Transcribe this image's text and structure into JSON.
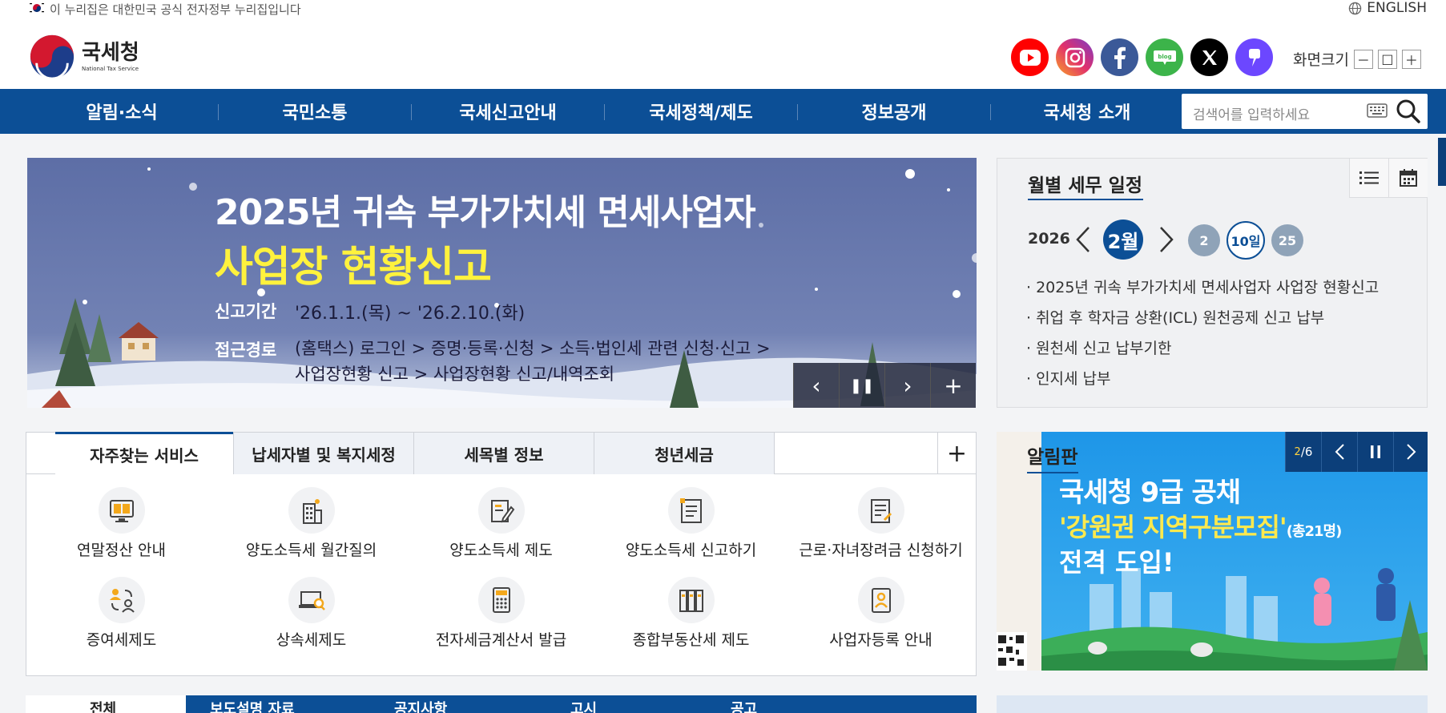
{
  "gov": {
    "text": "이 누리집은 대한민국 공식 전자정부 누리집입니다",
    "lang": "ENGLISH"
  },
  "logo": {
    "name": "국세청",
    "sub": "National Tax Service"
  },
  "sns": [
    {
      "name": "youtube",
      "color": "#ff0000"
    },
    {
      "name": "instagram",
      "color": "#d6249f"
    },
    {
      "name": "facebook",
      "color": "#3b5998"
    },
    {
      "name": "blog",
      "color": "#3cb44a"
    },
    {
      "name": "x",
      "color": "#000000"
    },
    {
      "name": "kakao",
      "color": "#6c47ff"
    }
  ],
  "zoom": {
    "label": "화면크기",
    "minus": "－",
    "reset": "□",
    "plus": "＋"
  },
  "nav": [
    "알림·소식",
    "국민소통",
    "국세신고안내",
    "국세정책/제도",
    "정보공개",
    "국세청 소개"
  ],
  "search": {
    "placeholder": "검색어를 입력하세요"
  },
  "banner": {
    "title1": "2025년 귀속 부가가치세 면세사업자",
    "title2": "사업장 현황신고",
    "row1_label": "신고기간",
    "row1_value": "'26.1.1.(목) ~ '26.2.10.(화)",
    "row2_label": "접근경로",
    "row2_value": "(홈택스) 로그인 > 증명·등록·신청 > 소득·법인세 관련 신청·신고 >",
    "row3_value": "사업장현황 신고 > 사업장현황 신고/내역조회",
    "controls": {
      "prev": "‹",
      "pause": "❚❚",
      "next": "›",
      "more": "+"
    }
  },
  "schedule": {
    "title": "월별 세무 일정",
    "year": "2026",
    "month": "2월",
    "days": [
      "2",
      "10일",
      "25"
    ],
    "items": [
      "· 2025년 귀속 부가가치세 면세사업자 사업장 현황신고",
      "· 취업 후 학자금 상환(ICL) 원천공제 신고 납부",
      "· 원천세 신고 납부기한",
      "· 인지세 납부"
    ]
  },
  "services": {
    "tabs": [
      "자주찾는 서비스",
      "납세자별 및 복지세정",
      "세목별 정보",
      "청년세금"
    ],
    "more": "+",
    "items": [
      {
        "label": "연말정산 안내",
        "icon": "computer-book-icon"
      },
      {
        "label": "양도소득세 월간질의",
        "icon": "building-icon"
      },
      {
        "label": "양도소득세 제도",
        "icon": "edit-doc-icon"
      },
      {
        "label": "양도소득세 신고하기",
        "icon": "document-icon"
      },
      {
        "label": "근로·자녀장려금 신청하기",
        "icon": "doc-pen-icon"
      },
      {
        "label": "증여세제도",
        "icon": "people-exchange-icon"
      },
      {
        "label": "상속세제도",
        "icon": "laptop-search-icon"
      },
      {
        "label": "전자세금계산서 발급",
        "icon": "calculator-icon"
      },
      {
        "label": "종합부동산세 제도",
        "icon": "binders-icon"
      },
      {
        "label": "사업자등록 안내",
        "icon": "id-card-icon"
      }
    ]
  },
  "notice": {
    "title": "알림판",
    "counter_current": "2",
    "counter_total": "6",
    "poster_line1": "국세청 9급 공채",
    "poster_line2": "'강원권 지역구분모집'",
    "poster_line2_note": "(총21명)",
    "poster_line3": "전격 도입!"
  },
  "bottom_tabs": [
    "전체",
    "보도설명 자료",
    "공지사항",
    "고시",
    "공고"
  ]
}
